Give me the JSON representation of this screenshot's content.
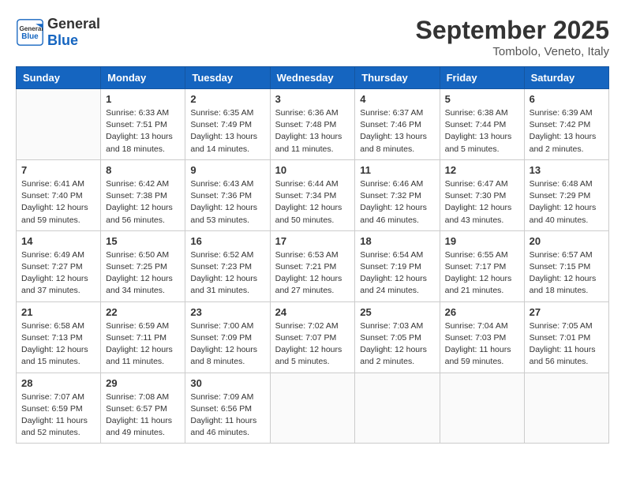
{
  "header": {
    "logo_general": "General",
    "logo_blue": "Blue",
    "month_title": "September 2025",
    "subtitle": "Tombolo, Veneto, Italy"
  },
  "weekdays": [
    "Sunday",
    "Monday",
    "Tuesday",
    "Wednesday",
    "Thursday",
    "Friday",
    "Saturday"
  ],
  "weeks": [
    [
      {
        "day": "",
        "info": ""
      },
      {
        "day": "1",
        "info": "Sunrise: 6:33 AM\nSunset: 7:51 PM\nDaylight: 13 hours\nand 18 minutes."
      },
      {
        "day": "2",
        "info": "Sunrise: 6:35 AM\nSunset: 7:49 PM\nDaylight: 13 hours\nand 14 minutes."
      },
      {
        "day": "3",
        "info": "Sunrise: 6:36 AM\nSunset: 7:48 PM\nDaylight: 13 hours\nand 11 minutes."
      },
      {
        "day": "4",
        "info": "Sunrise: 6:37 AM\nSunset: 7:46 PM\nDaylight: 13 hours\nand 8 minutes."
      },
      {
        "day": "5",
        "info": "Sunrise: 6:38 AM\nSunset: 7:44 PM\nDaylight: 13 hours\nand 5 minutes."
      },
      {
        "day": "6",
        "info": "Sunrise: 6:39 AM\nSunset: 7:42 PM\nDaylight: 13 hours\nand 2 minutes."
      }
    ],
    [
      {
        "day": "7",
        "info": "Sunrise: 6:41 AM\nSunset: 7:40 PM\nDaylight: 12 hours\nand 59 minutes."
      },
      {
        "day": "8",
        "info": "Sunrise: 6:42 AM\nSunset: 7:38 PM\nDaylight: 12 hours\nand 56 minutes."
      },
      {
        "day": "9",
        "info": "Sunrise: 6:43 AM\nSunset: 7:36 PM\nDaylight: 12 hours\nand 53 minutes."
      },
      {
        "day": "10",
        "info": "Sunrise: 6:44 AM\nSunset: 7:34 PM\nDaylight: 12 hours\nand 50 minutes."
      },
      {
        "day": "11",
        "info": "Sunrise: 6:46 AM\nSunset: 7:32 PM\nDaylight: 12 hours\nand 46 minutes."
      },
      {
        "day": "12",
        "info": "Sunrise: 6:47 AM\nSunset: 7:30 PM\nDaylight: 12 hours\nand 43 minutes."
      },
      {
        "day": "13",
        "info": "Sunrise: 6:48 AM\nSunset: 7:29 PM\nDaylight: 12 hours\nand 40 minutes."
      }
    ],
    [
      {
        "day": "14",
        "info": "Sunrise: 6:49 AM\nSunset: 7:27 PM\nDaylight: 12 hours\nand 37 minutes."
      },
      {
        "day": "15",
        "info": "Sunrise: 6:50 AM\nSunset: 7:25 PM\nDaylight: 12 hours\nand 34 minutes."
      },
      {
        "day": "16",
        "info": "Sunrise: 6:52 AM\nSunset: 7:23 PM\nDaylight: 12 hours\nand 31 minutes."
      },
      {
        "day": "17",
        "info": "Sunrise: 6:53 AM\nSunset: 7:21 PM\nDaylight: 12 hours\nand 27 minutes."
      },
      {
        "day": "18",
        "info": "Sunrise: 6:54 AM\nSunset: 7:19 PM\nDaylight: 12 hours\nand 24 minutes."
      },
      {
        "day": "19",
        "info": "Sunrise: 6:55 AM\nSunset: 7:17 PM\nDaylight: 12 hours\nand 21 minutes."
      },
      {
        "day": "20",
        "info": "Sunrise: 6:57 AM\nSunset: 7:15 PM\nDaylight: 12 hours\nand 18 minutes."
      }
    ],
    [
      {
        "day": "21",
        "info": "Sunrise: 6:58 AM\nSunset: 7:13 PM\nDaylight: 12 hours\nand 15 minutes."
      },
      {
        "day": "22",
        "info": "Sunrise: 6:59 AM\nSunset: 7:11 PM\nDaylight: 12 hours\nand 11 minutes."
      },
      {
        "day": "23",
        "info": "Sunrise: 7:00 AM\nSunset: 7:09 PM\nDaylight: 12 hours\nand 8 minutes."
      },
      {
        "day": "24",
        "info": "Sunrise: 7:02 AM\nSunset: 7:07 PM\nDaylight: 12 hours\nand 5 minutes."
      },
      {
        "day": "25",
        "info": "Sunrise: 7:03 AM\nSunset: 7:05 PM\nDaylight: 12 hours\nand 2 minutes."
      },
      {
        "day": "26",
        "info": "Sunrise: 7:04 AM\nSunset: 7:03 PM\nDaylight: 11 hours\nand 59 minutes."
      },
      {
        "day": "27",
        "info": "Sunrise: 7:05 AM\nSunset: 7:01 PM\nDaylight: 11 hours\nand 56 minutes."
      }
    ],
    [
      {
        "day": "28",
        "info": "Sunrise: 7:07 AM\nSunset: 6:59 PM\nDaylight: 11 hours\nand 52 minutes."
      },
      {
        "day": "29",
        "info": "Sunrise: 7:08 AM\nSunset: 6:57 PM\nDaylight: 11 hours\nand 49 minutes."
      },
      {
        "day": "30",
        "info": "Sunrise: 7:09 AM\nSunset: 6:56 PM\nDaylight: 11 hours\nand 46 minutes."
      },
      {
        "day": "",
        "info": ""
      },
      {
        "day": "",
        "info": ""
      },
      {
        "day": "",
        "info": ""
      },
      {
        "day": "",
        "info": ""
      }
    ]
  ]
}
